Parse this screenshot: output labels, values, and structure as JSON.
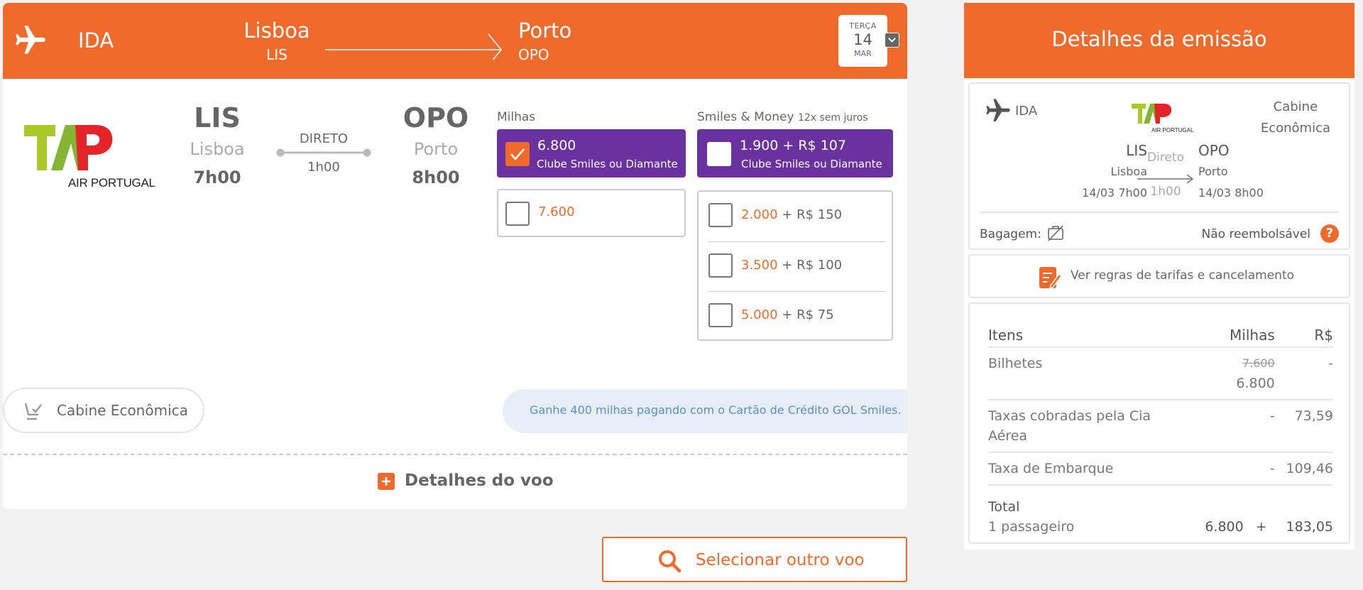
{
  "flight_header": {
    "direction": "IDA",
    "origin_city": "Lisboa",
    "origin_code": "LIS",
    "destination_city": "Porto",
    "destination_code": "OPO",
    "date_weekday": "TERÇA",
    "date_day": "14",
    "date_month": "MAR"
  },
  "flight": {
    "airline_logo_text": "AIR PORTUGAL",
    "origin_code": "LIS",
    "origin_city": "Lisboa",
    "departure_time": "7h00",
    "stops_label": "DIRETO",
    "duration": "1h00",
    "destination_code": "OPO",
    "destination_city": "Porto",
    "arrival_time": "8h00",
    "cabin_label": "Cabine Econômica"
  },
  "fare_options": {
    "miles_title": "Milhas",
    "miles_selected": {
      "value": "6.800",
      "sub": "Clube Smiles ou Diamante",
      "checked": true
    },
    "miles_regular": {
      "value": "7.600",
      "checked": false
    },
    "smiles_money_title": "Smiles & Money",
    "smiles_money_note": "12x sem juros",
    "smiles_money_club": {
      "value": "1.900 + R$ 107",
      "sub": "Clube Smiles ou Diamante",
      "checked": false
    },
    "smiles_money_rows": [
      {
        "miles": "2.000",
        "money": "+ R$ 150"
      },
      {
        "miles": "3.500",
        "money": "+ R$ 100"
      },
      {
        "miles": "5.000",
        "money": "+ R$ 75"
      }
    ]
  },
  "promo_text": "Ganhe 400 milhas pagando com o Cartão de Crédito GOL Smiles.",
  "details_link": "Detalhes do voo",
  "select_other_button": "Selecionar outro voo",
  "issue_panel": {
    "title": "Detalhes da emissão",
    "direction": "IDA",
    "cabin_line1": "Cabine",
    "cabin_line2": "Econômica",
    "origin_code": "LIS",
    "origin_city": "Lisboa",
    "origin_datetime": "14/03 7h00",
    "stops_label": "Direto",
    "duration": "1h00",
    "destination_code": "OPO",
    "destination_city": "Porto",
    "destination_datetime": "14/03 8h00",
    "baggage_label": "Bagagem:",
    "refund_label": "Não reembolsável",
    "help_symbol": "?",
    "rules_link": "Ver regras de tarifas e cancelamento",
    "table": {
      "headers": [
        "Itens",
        "Milhas",
        "R$"
      ],
      "rows": [
        {
          "item": "Bilhetes",
          "miles_old": "7.600",
          "miles": "6.800",
          "money": "-"
        },
        {
          "item": "Taxas cobradas pela Cia Aérea",
          "miles": "-",
          "money": "73,59"
        },
        {
          "item": "Taxa de Embarque",
          "miles": "-",
          "money": "109,46"
        }
      ],
      "total_label": "Total",
      "passengers": "1 passageiro",
      "total_miles": "6.800",
      "plus": "+",
      "total_money": "183,05"
    }
  },
  "colors": {
    "accent": "#ef6a2b",
    "purple": "#6a329f",
    "promo_bg": "#e8eef7",
    "promo_text": "#5b8fd0"
  }
}
